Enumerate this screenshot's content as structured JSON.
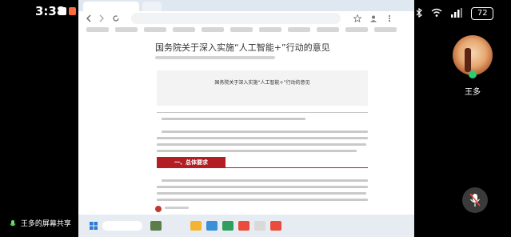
{
  "status_bar": {
    "time": "3:38",
    "battery": "72"
  },
  "browser": {
    "url": "",
    "page_title": "国务院关于深入实施“人工智能+”行动的意见",
    "doc_header_title": "国务院关于深入实施“人工智能+”行动的意见",
    "doc_number": "",
    "section_heading": "一、总体要求"
  },
  "call": {
    "caller_name": "王多",
    "share_label": "王多的屏幕共享"
  },
  "colors": {
    "accent_red": "#b21e23",
    "background": "#000000"
  }
}
